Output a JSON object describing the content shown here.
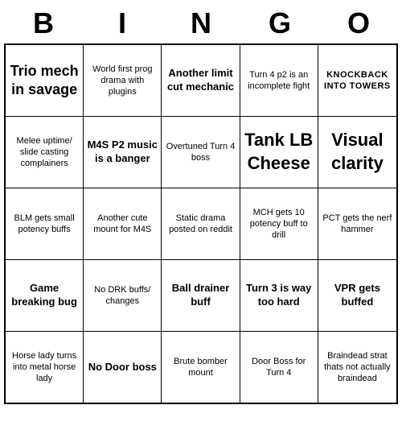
{
  "title": {
    "letters": [
      "B",
      "I",
      "N",
      "G",
      "O"
    ]
  },
  "grid": [
    [
      {
        "text": "Trio mech in savage",
        "style": "large-text"
      },
      {
        "text": "World first prog drama with plugins",
        "style": "normal"
      },
      {
        "text": "Another limit cut mechanic",
        "style": "medium-text"
      },
      {
        "text": "Turn 4 p2 is an incomplete fight",
        "style": "normal"
      },
      {
        "text": "KNOCKBACK INTO TOWERS",
        "style": "caps-text"
      }
    ],
    [
      {
        "text": "Melee uptime/ slide casting complainers",
        "style": "normal"
      },
      {
        "text": "M4S P2 music is a banger",
        "style": "medium-text"
      },
      {
        "text": "Overtuned Turn 4 boss",
        "style": "normal"
      },
      {
        "text": "Tank LB Cheese",
        "style": "xl-text"
      },
      {
        "text": "Visual clarity",
        "style": "xl-text"
      }
    ],
    [
      {
        "text": "BLM gets small potency buffs",
        "style": "normal"
      },
      {
        "text": "Another cute mount for M4S",
        "style": "normal"
      },
      {
        "text": "Static drama posted on reddit",
        "style": "normal"
      },
      {
        "text": "MCH gets 10 potency buff to drill",
        "style": "normal"
      },
      {
        "text": "PCT gets the nerf hammer",
        "style": "normal"
      }
    ],
    [
      {
        "text": "Game breaking bug",
        "style": "medium-text"
      },
      {
        "text": "No DRK buffs/ changes",
        "style": "normal"
      },
      {
        "text": "Ball drainer buff",
        "style": "medium-text"
      },
      {
        "text": "Turn 3 is way too hard",
        "style": "medium-text"
      },
      {
        "text": "VPR gets buffed",
        "style": "medium-text"
      }
    ],
    [
      {
        "text": "Horse lady turns into metal horse lady",
        "style": "normal"
      },
      {
        "text": "No Door boss",
        "style": "medium-text"
      },
      {
        "text": "Brute bomber mount",
        "style": "normal"
      },
      {
        "text": "Door Boss for Turn 4",
        "style": "normal"
      },
      {
        "text": "Braindead strat thats not actually braindead",
        "style": "normal"
      }
    ]
  ]
}
